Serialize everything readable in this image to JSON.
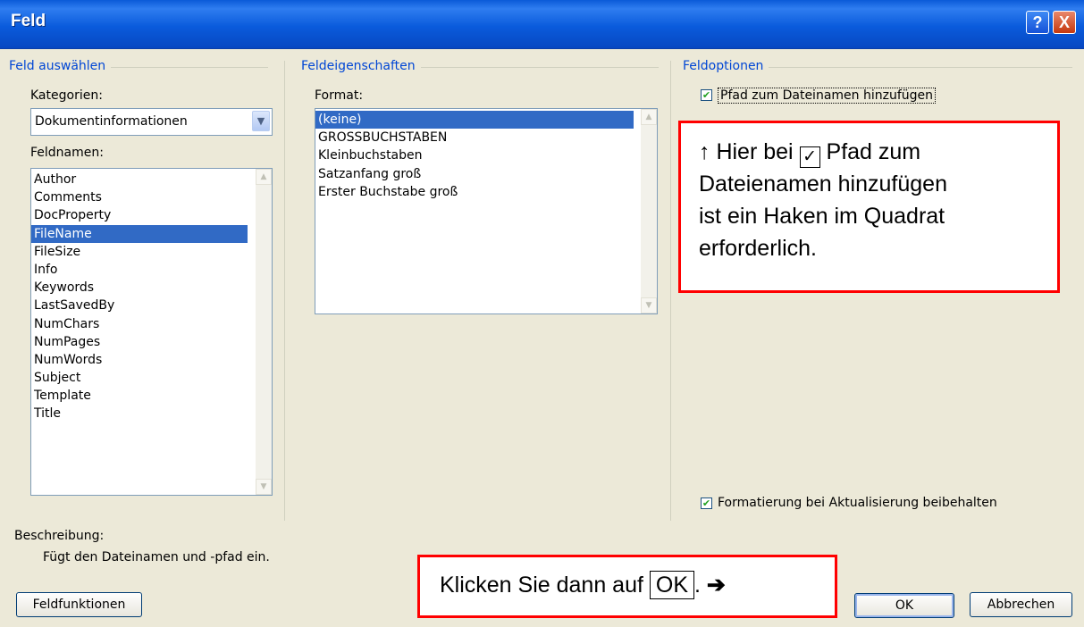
{
  "window": {
    "title": "Feld",
    "help_label": "?",
    "close_label": "X"
  },
  "select_field": {
    "group_title": "Feld auswählen",
    "categories_label": "Kategorien:",
    "categories_value": "Dokumentinformationen",
    "fieldnames_label": "Feldnamen:",
    "fieldnames": [
      "Author",
      "Comments",
      "DocProperty",
      "FileName",
      "FileSize",
      "Info",
      "Keywords",
      "LastSavedBy",
      "NumChars",
      "NumPages",
      "NumWords",
      "Subject",
      "Template",
      "Title"
    ],
    "selected_fieldname": "FileName"
  },
  "field_properties": {
    "group_title": "Feldeigenschaften",
    "format_label": "Format:",
    "formats": [
      "(keine)",
      "GROSSBUCHSTABEN",
      "Kleinbuchstaben",
      "Satzanfang groß",
      "Erster Buchstabe groß"
    ],
    "selected_format": "(keine)"
  },
  "field_options": {
    "group_title": "Feldoptionen",
    "add_path": {
      "label": "Pfad zum Dateinamen hinzufügen",
      "checked": true
    },
    "keep_formatting": {
      "label": "Formatierung bei Aktualisierung beibehalten",
      "checked": true
    }
  },
  "description": {
    "label": "Beschreibung:",
    "text": "Fügt den Dateinamen und -pfad ein."
  },
  "buttons": {
    "field_codes": "Feldfunktionen",
    "ok": "OK",
    "cancel": "Abbrechen"
  },
  "annotations": {
    "arrow_up": "↑",
    "callout_1_pre": "Hier bei",
    "callout_1_check": "✓",
    "callout_1_lines": [
      "Pfad zum",
      "Dateienamen hinzufügen",
      "ist ein Haken im Quadrat",
      "erforderlich."
    ],
    "callout_2_pre": "Klicken Sie dann auf",
    "callout_2_ok": "OK",
    "callout_2_post": ".",
    "callout_2_arrow": "➔"
  },
  "colors": {
    "title_bar": "#0a5ad8",
    "group_title": "#0046d5",
    "selection": "#316ac5",
    "callout_border": "#ff0000",
    "dialog_bg": "#ece9d8"
  }
}
